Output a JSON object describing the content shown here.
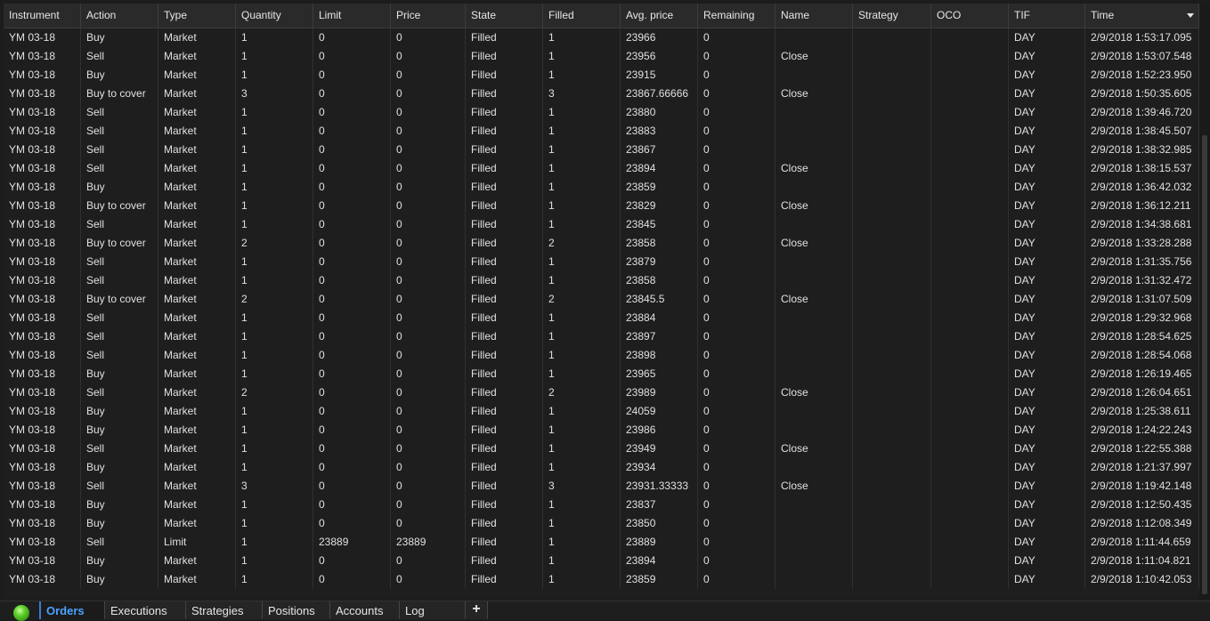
{
  "columns": [
    "Instrument",
    "Action",
    "Type",
    "Quantity",
    "Limit",
    "Price",
    "State",
    "Filled",
    "Avg. price",
    "Remaining",
    "Name",
    "Strategy",
    "OCO",
    "TIF",
    "Time"
  ],
  "rows": [
    [
      "YM 03-18",
      "Buy",
      "Market",
      "1",
      "0",
      "0",
      "Filled",
      "1",
      "23966",
      "0",
      "",
      "",
      "",
      "DAY",
      "2/9/2018 1:53:17.095"
    ],
    [
      "YM 03-18",
      "Sell",
      "Market",
      "1",
      "0",
      "0",
      "Filled",
      "1",
      "23956",
      "0",
      "Close",
      "",
      "",
      "DAY",
      "2/9/2018 1:53:07.548"
    ],
    [
      "YM 03-18",
      "Buy",
      "Market",
      "1",
      "0",
      "0",
      "Filled",
      "1",
      "23915",
      "0",
      "",
      "",
      "",
      "DAY",
      "2/9/2018 1:52:23.950"
    ],
    [
      "YM 03-18",
      "Buy to cover",
      "Market",
      "3",
      "0",
      "0",
      "Filled",
      "3",
      "23867.66666",
      "0",
      "Close",
      "",
      "",
      "DAY",
      "2/9/2018 1:50:35.605"
    ],
    [
      "YM 03-18",
      "Sell",
      "Market",
      "1",
      "0",
      "0",
      "Filled",
      "1",
      "23880",
      "0",
      "",
      "",
      "",
      "DAY",
      "2/9/2018 1:39:46.720"
    ],
    [
      "YM 03-18",
      "Sell",
      "Market",
      "1",
      "0",
      "0",
      "Filled",
      "1",
      "23883",
      "0",
      "",
      "",
      "",
      "DAY",
      "2/9/2018 1:38:45.507"
    ],
    [
      "YM 03-18",
      "Sell",
      "Market",
      "1",
      "0",
      "0",
      "Filled",
      "1",
      "23867",
      "0",
      "",
      "",
      "",
      "DAY",
      "2/9/2018 1:38:32.985"
    ],
    [
      "YM 03-18",
      "Sell",
      "Market",
      "1",
      "0",
      "0",
      "Filled",
      "1",
      "23894",
      "0",
      "Close",
      "",
      "",
      "DAY",
      "2/9/2018 1:38:15.537"
    ],
    [
      "YM 03-18",
      "Buy",
      "Market",
      "1",
      "0",
      "0",
      "Filled",
      "1",
      "23859",
      "0",
      "",
      "",
      "",
      "DAY",
      "2/9/2018 1:36:42.032"
    ],
    [
      "YM 03-18",
      "Buy to cover",
      "Market",
      "1",
      "0",
      "0",
      "Filled",
      "1",
      "23829",
      "0",
      "Close",
      "",
      "",
      "DAY",
      "2/9/2018 1:36:12.211"
    ],
    [
      "YM 03-18",
      "Sell",
      "Market",
      "1",
      "0",
      "0",
      "Filled",
      "1",
      "23845",
      "0",
      "",
      "",
      "",
      "DAY",
      "2/9/2018 1:34:38.681"
    ],
    [
      "YM 03-18",
      "Buy to cover",
      "Market",
      "2",
      "0",
      "0",
      "Filled",
      "2",
      "23858",
      "0",
      "Close",
      "",
      "",
      "DAY",
      "2/9/2018 1:33:28.288"
    ],
    [
      "YM 03-18",
      "Sell",
      "Market",
      "1",
      "0",
      "0",
      "Filled",
      "1",
      "23879",
      "0",
      "",
      "",
      "",
      "DAY",
      "2/9/2018 1:31:35.756"
    ],
    [
      "YM 03-18",
      "Sell",
      "Market",
      "1",
      "0",
      "0",
      "Filled",
      "1",
      "23858",
      "0",
      "",
      "",
      "",
      "DAY",
      "2/9/2018 1:31:32.472"
    ],
    [
      "YM 03-18",
      "Buy to cover",
      "Market",
      "2",
      "0",
      "0",
      "Filled",
      "2",
      "23845.5",
      "0",
      "Close",
      "",
      "",
      "DAY",
      "2/9/2018 1:31:07.509"
    ],
    [
      "YM 03-18",
      "Sell",
      "Market",
      "1",
      "0",
      "0",
      "Filled",
      "1",
      "23884",
      "0",
      "",
      "",
      "",
      "DAY",
      "2/9/2018 1:29:32.968"
    ],
    [
      "YM 03-18",
      "Sell",
      "Market",
      "1",
      "0",
      "0",
      "Filled",
      "1",
      "23897",
      "0",
      "",
      "",
      "",
      "DAY",
      "2/9/2018 1:28:54.625"
    ],
    [
      "YM 03-18",
      "Sell",
      "Market",
      "1",
      "0",
      "0",
      "Filled",
      "1",
      "23898",
      "0",
      "",
      "",
      "",
      "DAY",
      "2/9/2018 1:28:54.068"
    ],
    [
      "YM 03-18",
      "Buy",
      "Market",
      "1",
      "0",
      "0",
      "Filled",
      "1",
      "23965",
      "0",
      "",
      "",
      "",
      "DAY",
      "2/9/2018 1:26:19.465"
    ],
    [
      "YM 03-18",
      "Sell",
      "Market",
      "2",
      "0",
      "0",
      "Filled",
      "2",
      "23989",
      "0",
      "Close",
      "",
      "",
      "DAY",
      "2/9/2018 1:26:04.651"
    ],
    [
      "YM 03-18",
      "Buy",
      "Market",
      "1",
      "0",
      "0",
      "Filled",
      "1",
      "24059",
      "0",
      "",
      "",
      "",
      "DAY",
      "2/9/2018 1:25:38.611"
    ],
    [
      "YM 03-18",
      "Buy",
      "Market",
      "1",
      "0",
      "0",
      "Filled",
      "1",
      "23986",
      "0",
      "",
      "",
      "",
      "DAY",
      "2/9/2018 1:24:22.243"
    ],
    [
      "YM 03-18",
      "Sell",
      "Market",
      "1",
      "0",
      "0",
      "Filled",
      "1",
      "23949",
      "0",
      "Close",
      "",
      "",
      "DAY",
      "2/9/2018 1:22:55.388"
    ],
    [
      "YM 03-18",
      "Buy",
      "Market",
      "1",
      "0",
      "0",
      "Filled",
      "1",
      "23934",
      "0",
      "",
      "",
      "",
      "DAY",
      "2/9/2018 1:21:37.997"
    ],
    [
      "YM 03-18",
      "Sell",
      "Market",
      "3",
      "0",
      "0",
      "Filled",
      "3",
      "23931.33333",
      "0",
      "Close",
      "",
      "",
      "DAY",
      "2/9/2018 1:19:42.148"
    ],
    [
      "YM 03-18",
      "Buy",
      "Market",
      "1",
      "0",
      "0",
      "Filled",
      "1",
      "23837",
      "0",
      "",
      "",
      "",
      "DAY",
      "2/9/2018 1:12:50.435"
    ],
    [
      "YM 03-18",
      "Buy",
      "Market",
      "1",
      "0",
      "0",
      "Filled",
      "1",
      "23850",
      "0",
      "",
      "",
      "",
      "DAY",
      "2/9/2018 1:12:08.349"
    ],
    [
      "YM 03-18",
      "Sell",
      "Limit",
      "1",
      "23889",
      "23889",
      "Filled",
      "1",
      "23889",
      "0",
      "",
      "",
      "",
      "DAY",
      "2/9/2018 1:11:44.659"
    ],
    [
      "YM 03-18",
      "Buy",
      "Market",
      "1",
      "0",
      "0",
      "Filled",
      "1",
      "23894",
      "0",
      "",
      "",
      "",
      "DAY",
      "2/9/2018 1:11:04.821"
    ],
    [
      "YM 03-18",
      "Buy",
      "Market",
      "1",
      "0",
      "0",
      "Filled",
      "1",
      "23859",
      "0",
      "",
      "",
      "",
      "DAY",
      "2/9/2018 1:10:42.053"
    ]
  ],
  "tabs": [
    "Orders",
    "Executions",
    "Strategies",
    "Positions",
    "Accounts",
    "Log"
  ],
  "active_tab": "Orders",
  "add_tab_label": "+",
  "colors": {
    "background": "#1e1e1e",
    "header": "#2a2a2a",
    "active_tab_text": "#4aa3ff",
    "status_led": "#5fd12c"
  }
}
